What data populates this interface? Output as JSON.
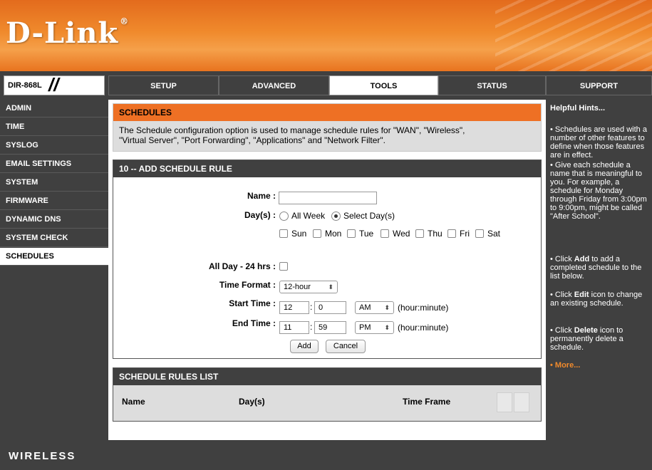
{
  "brand": {
    "logo": "D-Link",
    "reg_mark": "®"
  },
  "model": "DIR-868L",
  "tabs": [
    {
      "label": "SETUP"
    },
    {
      "label": "ADVANCED"
    },
    {
      "label": "TOOLS"
    },
    {
      "label": "STATUS"
    },
    {
      "label": "SUPPORT"
    }
  ],
  "sidebar": {
    "items": [
      {
        "label": "ADMIN"
      },
      {
        "label": "TIME"
      },
      {
        "label": "SYSLOG"
      },
      {
        "label": "EMAIL SETTINGS"
      },
      {
        "label": "SYSTEM"
      },
      {
        "label": "FIRMWARE"
      },
      {
        "label": "DYNAMIC DNS"
      },
      {
        "label": "SYSTEM CHECK"
      },
      {
        "label": "SCHEDULES"
      }
    ]
  },
  "schedules": {
    "title": "SCHEDULES",
    "description_line1": "The Schedule configuration option is used to manage schedule rules for \"WAN\", \"Wireless\",",
    "description_line2": "\"Virtual Server\", \"Port Forwarding\", \"Applications\" and \"Network Filter\"."
  },
  "rule": {
    "title": "10 -- ADD SCHEDULE RULE",
    "name_label": "Name :",
    "name_value": "",
    "days_label": "Day(s) :",
    "all_week": "All Week",
    "select_days": "Select Day(s)",
    "days": [
      "Sun",
      "Mon",
      "Tue",
      "Wed",
      "Thu",
      "Fri",
      "Sat"
    ],
    "allday_label": "All Day - 24 hrs :",
    "time_format_label": "Time Format :",
    "time_format_value": "12-hour",
    "start_label": "Start Time :",
    "start_hour": "12",
    "start_minute": "0",
    "start_ampm": "AM",
    "end_label": "End Time :",
    "end_hour": "11",
    "end_minute": "59",
    "end_ampm": "PM",
    "hint_hm": "(hour:minute)",
    "colon": ":",
    "add_button": "Add",
    "cancel_button": "Cancel"
  },
  "list": {
    "title": "SCHEDULE RULES LIST",
    "col_name": "Name",
    "col_days": "Day(s)",
    "col_time": "Time Frame"
  },
  "hints": {
    "title": "Helpful Hints...",
    "h1": "• Schedules are used with a number of other features to define when those features are in effect.",
    "h2": "• Give each schedule a name that is meaningful to you. For example, a schedule for Monday through Friday from 3:00pm to 9:00pm, might be called \"After School\".",
    "h3_pre": "• Click ",
    "h3_bold": "Add",
    "h3_post": " to add a completed schedule to the list below.",
    "h4_pre": "• Click ",
    "h4_bold": "Edit",
    "h4_post": " icon to change an existing schedule.",
    "h5_pre": "• Click ",
    "h5_bold": "Delete",
    "h5_post": " icon to permanently delete a schedule.",
    "more": "• More..."
  },
  "footer": {
    "label": "WIRELESS"
  },
  "colors": {
    "orange": "#ee7024",
    "dark": "#404040"
  }
}
